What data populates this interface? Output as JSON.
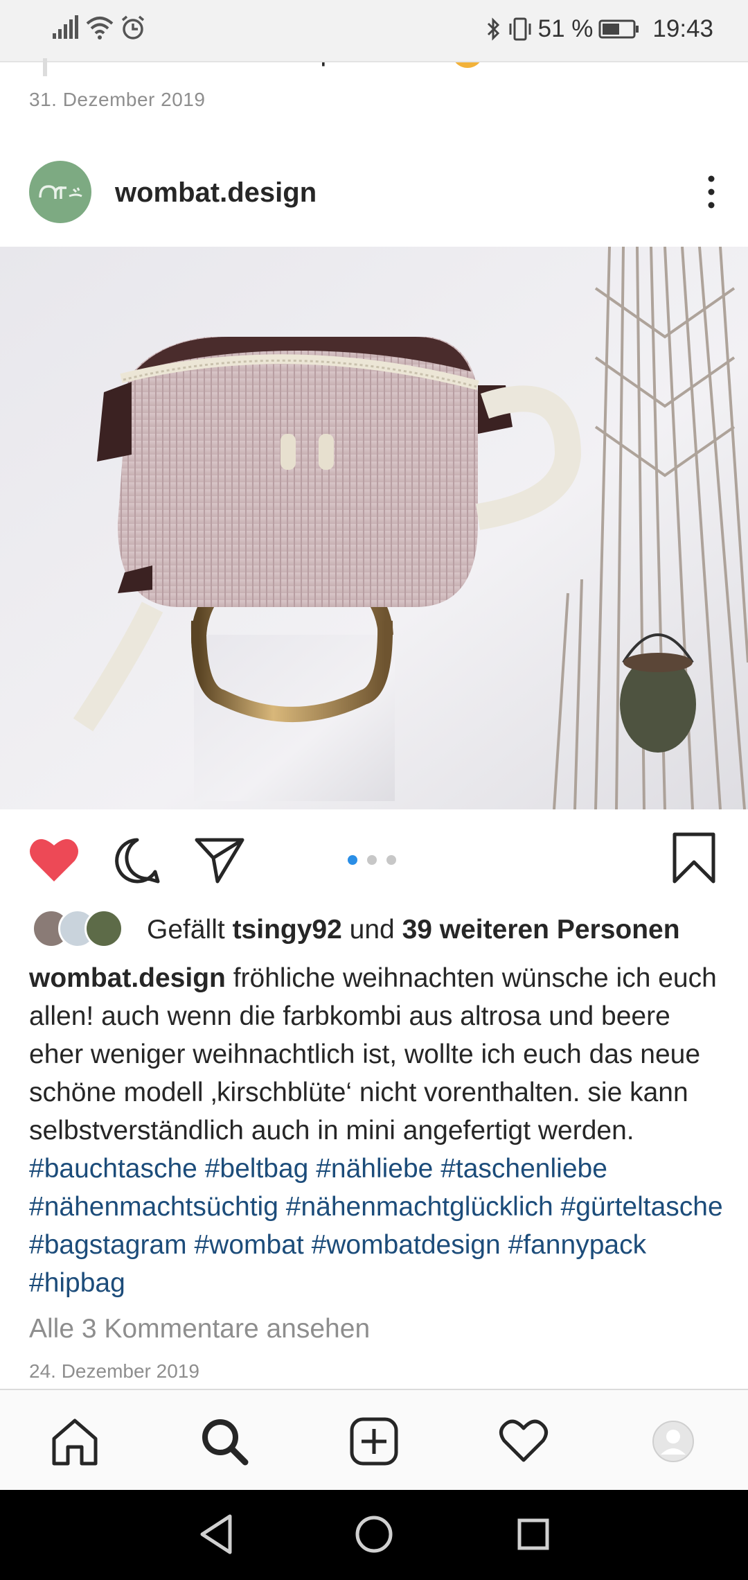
{
  "status_bar": {
    "battery": "51 %",
    "time": "19:43",
    "icons": [
      "signal-icon",
      "wifi-icon",
      "alarm-icon",
      "bluetooth-icon",
      "vibrate-icon",
      "battery-icon"
    ]
  },
  "previous_post": {
    "caption_tail": "können wir alles besprechen.",
    "date": "31. Dezember 2019"
  },
  "post": {
    "username": "wombat.design",
    "avatar_text": "ατ",
    "likes": {
      "prefix": "Gefällt",
      "user": "tsingy92",
      "conjunction": "und",
      "others": "39 weiteren Personen"
    },
    "caption": {
      "user": "wombat.design",
      "text": "fröhliche weihnachten wünsche ich euch allen! auch wenn die farbkombi aus altrosa und beere eher weniger weihnachtlich ist, wollte ich euch das neue schöne modell ‚kirschblüte‘ nicht vorenthalten. sie kann selbstverständlich auch in mini angefertigt werden. ",
      "hashtags": [
        "#bauchtasche",
        "#beltbag",
        "#nähliebe",
        "#taschenliebe",
        "#nähenmachtsüchtig",
        "#nähenmachtglücklich",
        "#gürteltasche",
        "#bagstagram",
        "#wombat",
        "#wombatdesign",
        "#fannypack",
        "#hipbag"
      ]
    },
    "view_comments": "Alle 3 Kommentare ansehen",
    "date": "24. Dezember 2019",
    "carousel": {
      "count": 3,
      "active": 1
    }
  },
  "colors": {
    "like_red": "#ed4956",
    "hashtag": "#1c4c7a",
    "muted": "#8e8e8e",
    "carousel_active": "#2a8ee6"
  },
  "bottom_nav": [
    "home-icon",
    "search-icon",
    "new-post-icon",
    "activity-icon",
    "profile-icon"
  ],
  "system_nav": [
    "back-icon",
    "home-circle-icon",
    "recents-icon"
  ]
}
